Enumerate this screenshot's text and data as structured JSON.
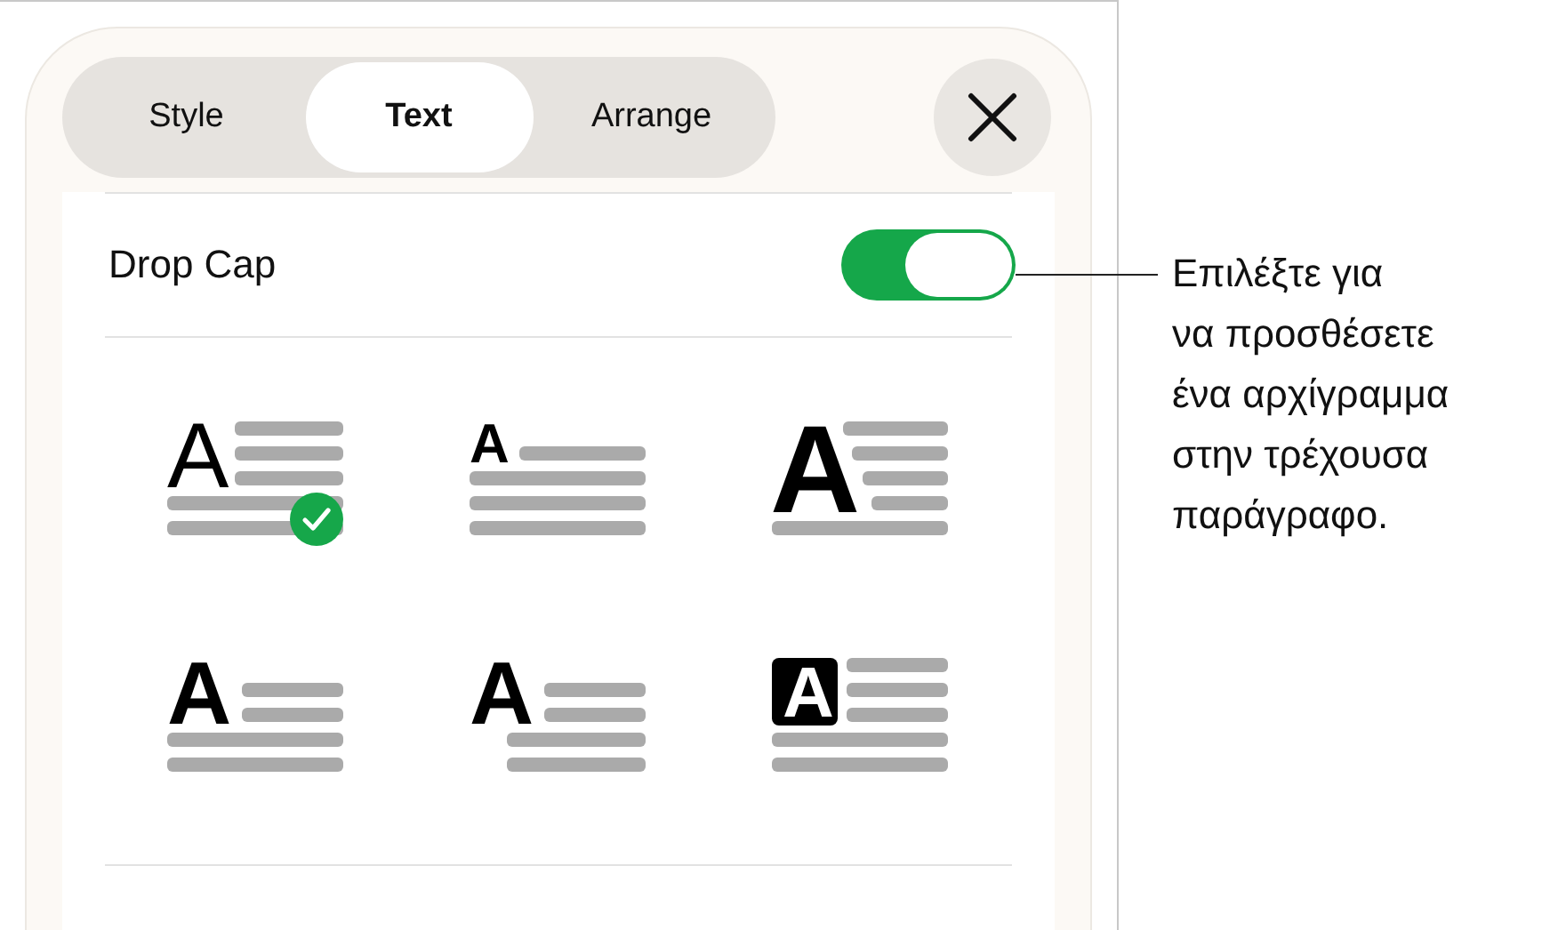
{
  "tabs": [
    {
      "label": "Style",
      "selected": false
    },
    {
      "label": "Text",
      "selected": true
    },
    {
      "label": "Arrange",
      "selected": false
    }
  ],
  "drop_cap": {
    "label": "Drop Cap",
    "on": true
  },
  "styles": [
    {
      "kind": "thin",
      "letter": "A",
      "selected": true
    },
    {
      "kind": "small",
      "letter": "A",
      "selected": false
    },
    {
      "kind": "large",
      "letter": "A",
      "selected": false
    },
    {
      "kind": "bold",
      "letter": "A",
      "selected": false
    },
    {
      "kind": "hanging",
      "letter": "A",
      "selected": false
    },
    {
      "kind": "boxed",
      "letter": "A",
      "selected": false
    }
  ],
  "callout": "Επιλέξτε για\nνα προσθέσετε\nένα αρχίγραμμα\nστην τρέχουσα\nπαράγραφο."
}
